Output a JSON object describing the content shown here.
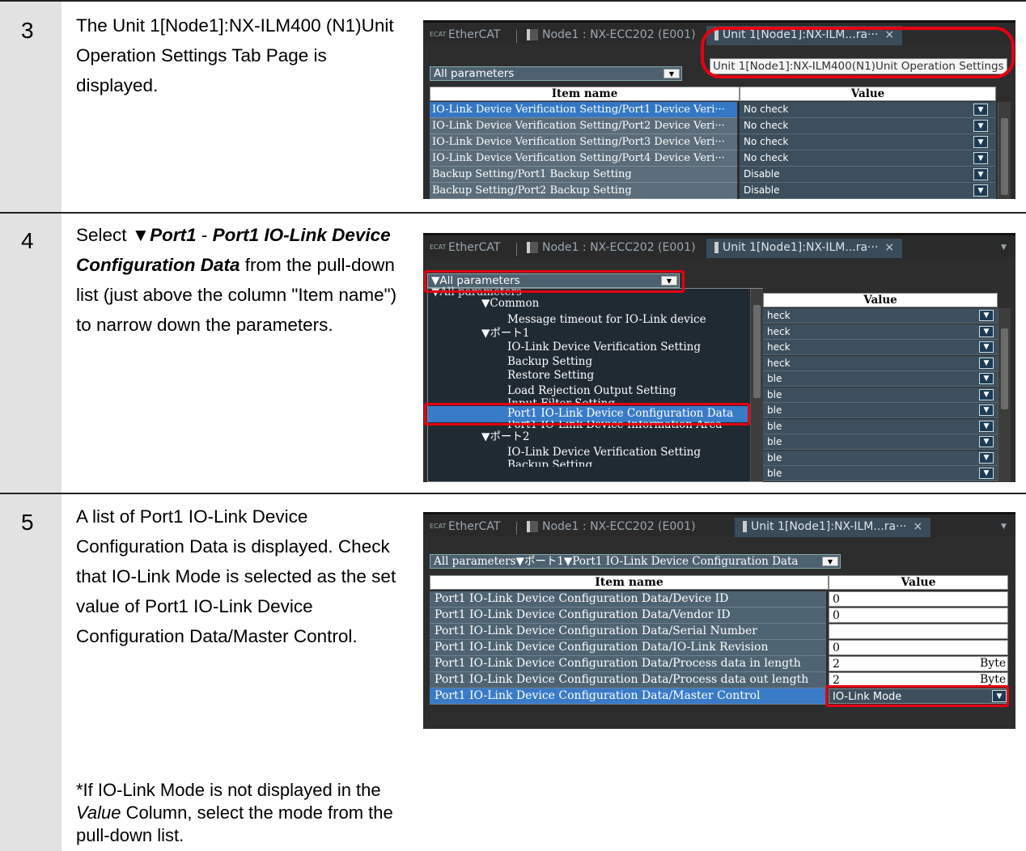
{
  "steps": [
    {
      "number": "3",
      "text_html": "The Unit 1[Node1]:NX-ILM400 (N1)Unit Operation Settings Tab Page is displayed."
    },
    {
      "number": "4",
      "text_parts": [
        "Select ",
        "▼Port1",
        " - ",
        "Port1 IO-Link Device Configuration Data",
        " from the pull-down list (just above the column \"Item name\") to narrow down the parameters."
      ]
    },
    {
      "number": "5",
      "text_main": "A list of Port1 IO-Link Device Configuration Data is displayed. Check that IO-Link Mode is selected as the set value of Port1 IO-Link Device Configuration Data/Master Control.",
      "note_parts": [
        "*If IO-Link Mode is not displayed in the ",
        "Value",
        " Column, select the mode from the pull-down list."
      ]
    }
  ],
  "tabs": {
    "ethercat": "EtherCAT",
    "ethercat_icon_text": "ECAT",
    "node1": "Node1 : NX-ECC202 (E001)",
    "unit1": "Unit 1[Node1]:NX-ILM...ra···",
    "close": "×",
    "tooltip": "Unit 1[Node1]:NX-ILM400(N1)Unit Operation Settings"
  },
  "shot3": {
    "filter": "All parameters",
    "col_item": "Item name",
    "col_value": "Value",
    "rows": [
      {
        "name": "IO-Link Device Verification Setting/Port1 Device Veri···",
        "value": "No check"
      },
      {
        "name": "IO-Link Device Verification Setting/Port2 Device Veri···",
        "value": "No check"
      },
      {
        "name": "IO-Link Device Verification Setting/Port3 Device Veri···",
        "value": "No check"
      },
      {
        "name": "IO-Link Device Verification Setting/Port4 Device Veri···",
        "value": "No check"
      },
      {
        "name": "Backup Setting/Port1 Backup Setting",
        "value": "Disable"
      },
      {
        "name": "Backup Setting/Port2 Backup Setting",
        "value": "Disable"
      }
    ]
  },
  "shot4": {
    "filter": "▼All parameters",
    "col_value": "Value",
    "tree": [
      "▼All parameters",
      "▼Common",
      "Message timeout for IO-Link device",
      "▼ポート1",
      "IO-Link Device Verification Setting",
      "Backup Setting",
      "Restore Setting",
      "Load Rejection Output Setting",
      "Input Filter Setting",
      "Port1 IO-Link Device Configuration Data",
      "Port1 IO-Link Device Information Area",
      "▼ポート2",
      "IO-Link Device Verification Setting",
      "Backup Setting"
    ],
    "values": [
      "heck",
      "heck",
      "heck",
      "heck",
      "ble",
      "ble",
      "ble",
      "ble",
      "ble",
      "ble",
      "ble",
      "ble"
    ]
  },
  "shot5": {
    "filter": "All parameters▼ポート1▼Port1 IO-Link Device Configuration Data",
    "col_item": "Item name",
    "col_value": "Value",
    "rows": [
      {
        "name": "Port1 IO-Link Device Configuration Data/Device ID",
        "value": "0",
        "unit": ""
      },
      {
        "name": "Port1 IO-Link Device Configuration Data/Vendor ID",
        "value": "0",
        "unit": ""
      },
      {
        "name": "Port1 IO-Link Device Configuration Data/Serial Number",
        "value": "",
        "unit": ""
      },
      {
        "name": "Port1 IO-Link Device Configuration Data/IO-Link Revision",
        "value": "0",
        "unit": ""
      },
      {
        "name": "Port1 IO-Link Device Configuration Data/Process data in length",
        "value": "2",
        "unit": "Byte"
      },
      {
        "name": "Port1 IO-Link Device Configuration Data/Process data out length",
        "value": "2",
        "unit": "Byte"
      },
      {
        "name": "Port1 IO-Link Device Configuration Data/Master Control",
        "value": "IO-Link Mode",
        "unit": ""
      }
    ]
  },
  "colors": {
    "highlight": "#e60012",
    "step_column": "#e2e2e2",
    "tab_active": "#3a4b59"
  }
}
